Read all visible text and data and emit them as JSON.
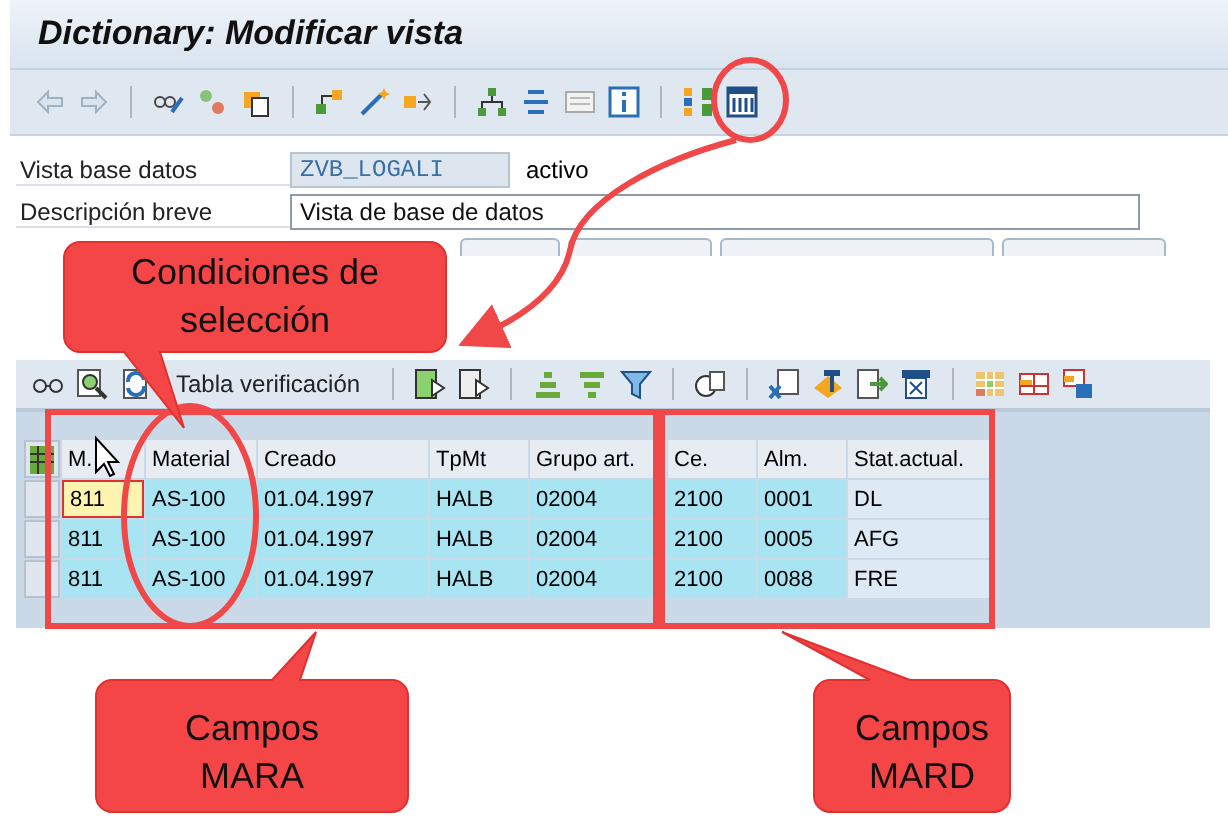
{
  "window": {
    "title": "Dictionary: Modificar vista"
  },
  "form": {
    "fields": [
      {
        "label": "Vista base datos",
        "value": "ZVB_LOGALI",
        "status": "activo",
        "readonly": true
      },
      {
        "label": "Descripción breve",
        "value": "Vista de base de datos",
        "readonly": false
      }
    ]
  },
  "alv_toolbar": {
    "button_label": "Tabla verificación"
  },
  "table": {
    "columns": [
      {
        "label": "M.",
        "key": true
      },
      {
        "label": "Material",
        "key": true
      },
      {
        "label": "Creado",
        "key": true
      },
      {
        "label": "TpMt",
        "key": true
      },
      {
        "label": "Grupo art.",
        "key": true
      },
      {
        "label": "Ce.",
        "key": true
      },
      {
        "label": "Alm.",
        "key": true
      },
      {
        "label": "Stat.actual.",
        "key": false
      }
    ],
    "rows": [
      {
        "cells": [
          "811",
          "AS-100",
          "01.04.1997",
          "HALB",
          "02004",
          "2100",
          "0001",
          "DL"
        ],
        "focused": true
      },
      {
        "cells": [
          "811",
          "AS-100",
          "01.04.1997",
          "HALB",
          "02004",
          "2100",
          "0005",
          "AFG"
        ],
        "focused": false
      },
      {
        "cells": [
          "811",
          "AS-100",
          "01.04.1997",
          "HALB",
          "02004",
          "2100",
          "0088",
          "FRE"
        ],
        "focused": false
      }
    ]
  },
  "annotations": [
    {
      "text": "Condiciones de selección"
    },
    {
      "text": "Campos MARA"
    },
    {
      "text": "Campos MARD"
    }
  ]
}
